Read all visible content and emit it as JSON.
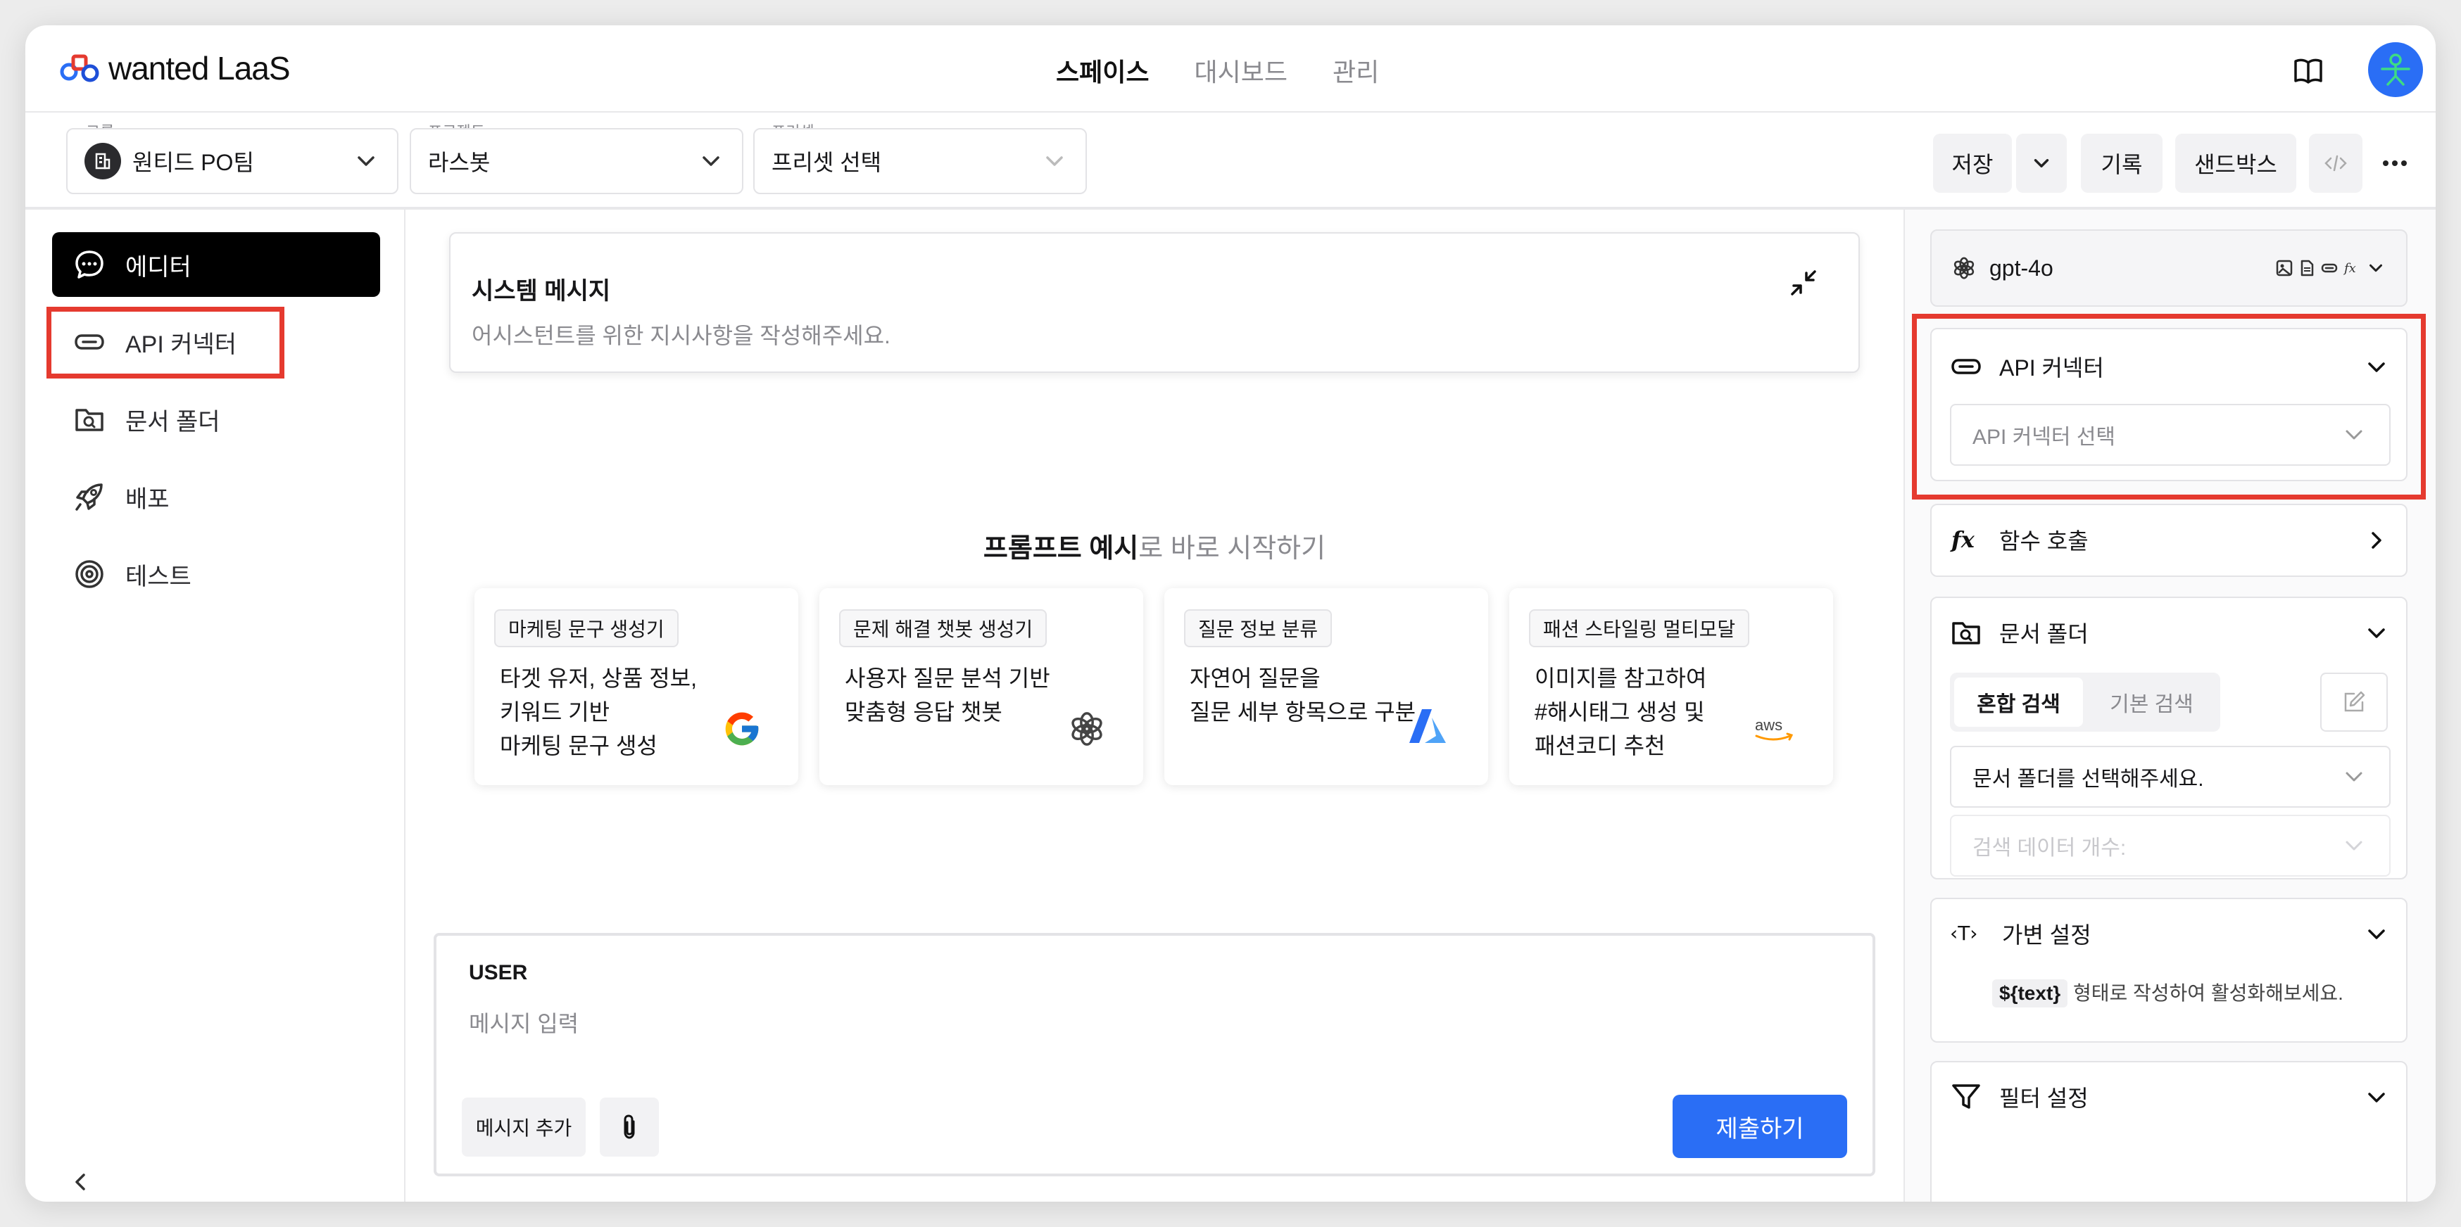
{
  "app": {
    "logo_text": "wanted LaaS"
  },
  "nav": {
    "tabs": [
      "스페이스",
      "대시보드",
      "관리"
    ],
    "active_index": 0
  },
  "toolbar": {
    "group": {
      "label": "그룹",
      "value": "원티드 PO팀"
    },
    "project": {
      "label": "프로젝트",
      "value": "라스봇"
    },
    "preset": {
      "label": "프리셋",
      "value": "프리셋 선택"
    },
    "save_label": "저장",
    "history_label": "기록",
    "sandbox_label": "샌드박스"
  },
  "sidebar": {
    "items": [
      {
        "label": "에디터",
        "icon": "chat-bubble-icon",
        "active": true
      },
      {
        "label": "API 커넥터",
        "icon": "link-icon",
        "active": false
      },
      {
        "label": "문서 폴더",
        "icon": "folder-search-icon",
        "active": false
      },
      {
        "label": "배포",
        "icon": "rocket-icon",
        "active": false
      },
      {
        "label": "테스트",
        "icon": "target-icon",
        "active": false
      }
    ]
  },
  "system": {
    "title": "시스템 메시지",
    "placeholder": "어시스턴트를 위한 지시사항을 작성해주세요."
  },
  "prompt_examples": {
    "heading_bold": "프롬프트 예시",
    "heading_rest": "로 바로 시작하기",
    "cards": [
      {
        "tag": "마케팅 문구 생성기",
        "lines": [
          "타겟 유저, 상품 정보,",
          "키워드 기반",
          "마케팅 문구 생성"
        ],
        "logo": "google-icon"
      },
      {
        "tag": "문제 해결 챗봇 생성기",
        "lines": [
          "사용자 질문 분석 기반",
          "맞춤형 응답 챗봇"
        ],
        "logo": "openai-icon"
      },
      {
        "tag": "질문 정보 분류",
        "lines": [
          "자연어 질문을",
          "질문 세부 항목으로 구분"
        ],
        "logo": "azure-icon"
      },
      {
        "tag": "패션 스타일링 멀티모달",
        "lines": [
          "이미지를 참고하여",
          "#해시태그 생성 및",
          "패션코디 추천"
        ],
        "logo": "aws-icon"
      }
    ]
  },
  "user_message": {
    "label": "USER",
    "placeholder": "메시지 입력",
    "add_label": "메시지 추가",
    "submit_label": "제출하기"
  },
  "right_panel": {
    "model": "gpt-4o",
    "api_connector": {
      "title": "API 커넥터",
      "select_placeholder": "API 커넥터 선택"
    },
    "function_call": {
      "title": "함수 호출"
    },
    "doc_folder": {
      "title": "문서 폴더",
      "search_modes": [
        "혼합 검색",
        "기본 검색"
      ],
      "active_mode": 0,
      "folder_placeholder": "문서 폴더를 선택해주세요.",
      "count_placeholder": "검색 데이터 개수:"
    },
    "variable": {
      "title": "가변 설정",
      "chip": "${text}",
      "hint": "형태로 작성하여 활성화해보세요."
    },
    "filter": {
      "title": "필터 설정"
    }
  },
  "colors": {
    "accent": "#2a6ef5",
    "highlight": "#e53a2f"
  }
}
